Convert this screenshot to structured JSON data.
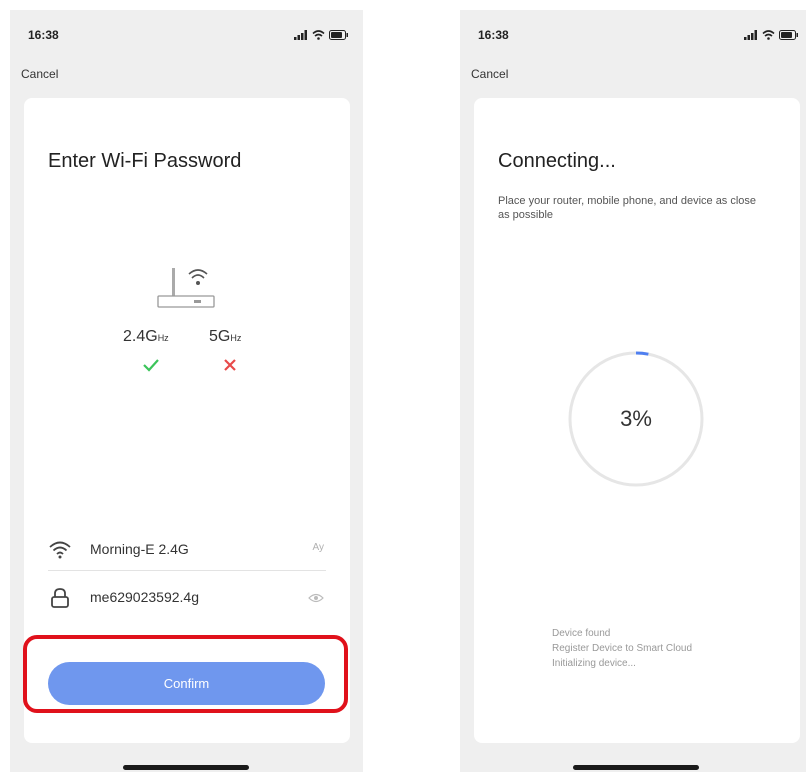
{
  "left_screen": {
    "status": {
      "time": "16:38"
    },
    "cancel_label": "Cancel",
    "title": "Enter Wi-Fi Password",
    "bands": {
      "band_24": {
        "value": "2.4G",
        "unit": "Hz"
      },
      "band_5": {
        "value": "5G",
        "unit": "Hz"
      }
    },
    "ssid": {
      "value": "Morning-E 2.4G",
      "switch_label": "Ау"
    },
    "password": {
      "value": "me629023592.4g"
    },
    "confirm_label": "Confirm"
  },
  "right_screen": {
    "status": {
      "time": "16:38"
    },
    "cancel_label": "Cancel",
    "title": "Connecting...",
    "instruction": "Place your router, mobile phone, and device as close as possible",
    "progress": {
      "value": 3,
      "label": "3%"
    },
    "steps": [
      "Device found",
      "Register Device to Smart Cloud",
      "Initializing device..."
    ]
  },
  "colors": {
    "accent": "#6f97ee",
    "progress": "#4f7ff0",
    "success": "#3cc45a",
    "error": "#e84a4a",
    "highlight": "#e0111b"
  }
}
